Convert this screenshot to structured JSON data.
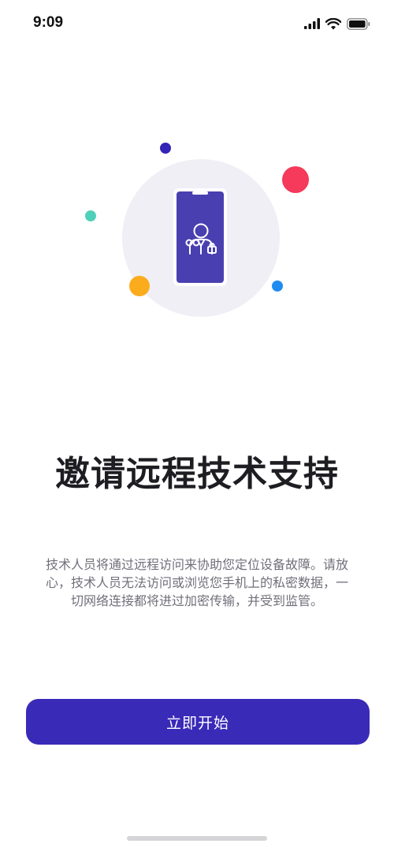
{
  "status_bar": {
    "time": "9:09",
    "icons": [
      "signal-icon",
      "wifi-icon",
      "battery-icon"
    ]
  },
  "illustration": {
    "icon": "technician-phone-icon",
    "colors": {
      "circle_bg": "#f0eff6",
      "phone_screen": "#4a3fb0",
      "dot_navy": "#3524b5",
      "dot_red": "#f53a5b",
      "dot_teal": "#4ed1b8",
      "dot_orange": "#fbac1d",
      "dot_blue": "#1e8cf0"
    }
  },
  "main": {
    "title": "邀请远程技术支持",
    "description": "技术人员将通过远程访问来协助您定位设备故障。请放心，技术人员无法访问或浏览您手机上的私密数据，一切网络连接都将进过加密传输，并受到监管。",
    "start_button_label": "立即开始"
  },
  "theme": {
    "accent": "#3a2ab8"
  }
}
